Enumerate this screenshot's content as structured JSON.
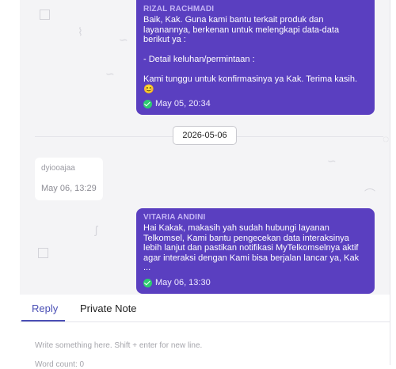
{
  "messages": [
    {
      "sender": "RIZAL RACHMADI",
      "text": "Baik, Kak. Guna kami bantu terkait produk dan layanannya, berkenan untuk melengkapi data-data berikut ya :\n\n- Detail keluhan/permintaan :\n\nKami tunggu untuk konfirmasinya ya Kak. Terima kasih. 😊",
      "time": "May 05, 20:34"
    },
    {
      "sender": "VITARIA ANDINI",
      "text": "Hai Kakak, makasih yah sudah hubungi layanan Telkomsel, Kami bantu pengecekan data interaksinya lebih lanjut dan pastikan notifikasi MyTelkomselnya aktif agar interaksi dengan Kami bisa berjalan lancar ya, Kak ...",
      "time": "May 06, 13:30"
    }
  ],
  "date_divider": "2026-05-06",
  "incoming": {
    "text": "dyiooajaa",
    "time": "May 06, 13:29"
  },
  "tabs": {
    "reply": "Reply",
    "private_note": "Private Note"
  },
  "composer": {
    "placeholder": "Write something here. Shift + enter for new line.",
    "word_count": "Word count: 0"
  },
  "colors": {
    "bubble": "#5a3fc0",
    "accent": "#4a4fb5",
    "delivered": "#2ecc71"
  },
  "icons": {
    "delivered": "check-circle-icon"
  }
}
